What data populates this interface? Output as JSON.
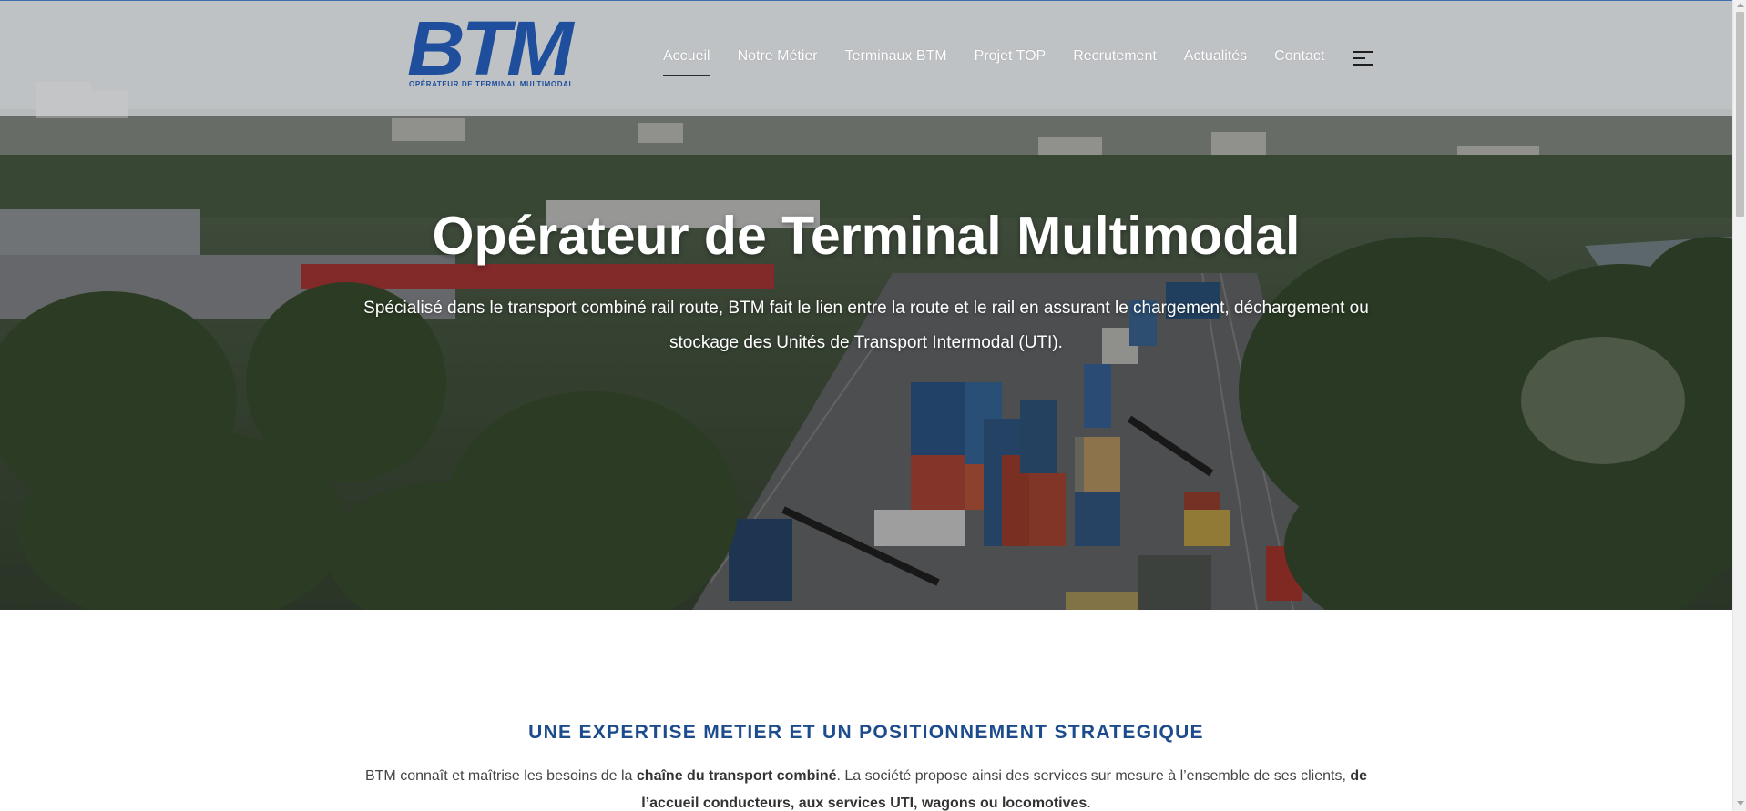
{
  "brand": {
    "logo_text": "BTM",
    "logo_tagline": "OPÉRATEUR DE TERMINAL MULTIMODAL",
    "color": "#1f4e9c"
  },
  "nav": {
    "items": [
      {
        "label": "Accueil",
        "active": true
      },
      {
        "label": "Notre Métier",
        "active": false
      },
      {
        "label": "Terminaux BTM",
        "active": false
      },
      {
        "label": "Projet TOP",
        "active": false
      },
      {
        "label": "Recrutement",
        "active": false
      },
      {
        "label": "Actualités",
        "active": false
      },
      {
        "label": "Contact",
        "active": false
      }
    ],
    "menu_icon": "hamburger-menu-icon"
  },
  "hero": {
    "title": "Opérateur de Terminal Multimodal",
    "subtitle": "Spécialisé dans le transport combiné rail route, BTM fait le lien entre la route et le rail en assurant le chargement, déchargement ou stockage des Unités de Transport Intermodal (UTI)."
  },
  "section": {
    "title": "UNE EXPERTISE METIER ET UN POSITIONNEMENT STRATEGIQUE",
    "text_1": "BTM connaît et maîtrise les besoins de la ",
    "bold_1": "chaîne du transport combiné",
    "text_2": ". La société propose ainsi des services sur mesure à l’ensemble de ses clients, ",
    "bold_2": "de l’accueil conducteurs, aux services UTI, wagons ou locomotives",
    "text_3": ".",
    "title_color": "#1d4c8c"
  }
}
